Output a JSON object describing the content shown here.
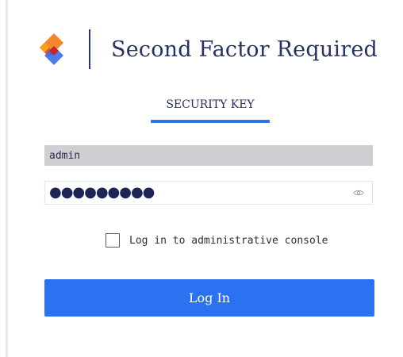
{
  "header": {
    "logo_icon": "brand-chevron-logo",
    "title": "Second Factor Required"
  },
  "tabs": [
    {
      "label": "SECURITY KEY",
      "active": true
    }
  ],
  "form": {
    "username_value": "admin",
    "password_masked": "●●●●●●●●●",
    "password_toggle_icon": "eye-icon",
    "admin_checkbox": {
      "label": "Log in to administrative console",
      "checked": false
    },
    "submit_label": "Log In"
  },
  "colors": {
    "accent": "#2a72f0",
    "title_text": "#263262",
    "field_fill": "#cfcfd3",
    "logo_orange": "#f58220",
    "logo_blue": "#3b6ee8"
  }
}
